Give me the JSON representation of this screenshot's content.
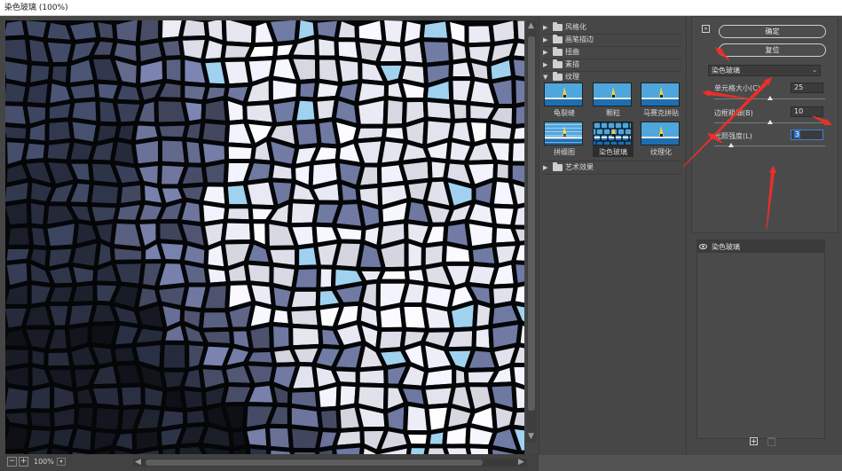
{
  "window": {
    "title": "染色玻璃 (100%)"
  },
  "preview": {
    "zoom": "100%",
    "zoom_out_label": "−",
    "zoom_in_label": "+",
    "dropdown_glyph": "▾"
  },
  "gallery": {
    "folders": [
      {
        "label": "风格化",
        "expanded": false
      },
      {
        "label": "画笔描边",
        "expanded": false
      },
      {
        "label": "扭曲",
        "expanded": false
      },
      {
        "label": "素描",
        "expanded": false
      },
      {
        "label": "纹理",
        "expanded": true
      }
    ],
    "filters": [
      {
        "label": "龟裂缝",
        "selected": false
      },
      {
        "label": "颗粒",
        "selected": false
      },
      {
        "label": "马赛克拼贴",
        "selected": false
      },
      {
        "label": "拼缀图",
        "selected": false
      },
      {
        "label": "染色玻璃",
        "selected": true
      },
      {
        "label": "纹理化",
        "selected": false
      }
    ],
    "last_folder": {
      "label": "艺术效果",
      "expanded": false
    }
  },
  "settings": {
    "help_label": "»",
    "ok_label": "确定",
    "reset_label": "复位",
    "filter_select": "染色玻璃",
    "params": [
      {
        "label": "单元格大小(C)",
        "value": "25"
      },
      {
        "label": "边框粗细(B)",
        "value": "10"
      },
      {
        "label": "光照强度(L)",
        "value": "3"
      }
    ],
    "slider_levels": [
      0.5,
      0.5,
      0.15
    ]
  },
  "layers": {
    "items": [
      {
        "name": "染色玻璃",
        "visible": true
      }
    ]
  },
  "colors": {
    "annotation_red": "#e8302a",
    "accent_blue": "#3d7fd9"
  }
}
